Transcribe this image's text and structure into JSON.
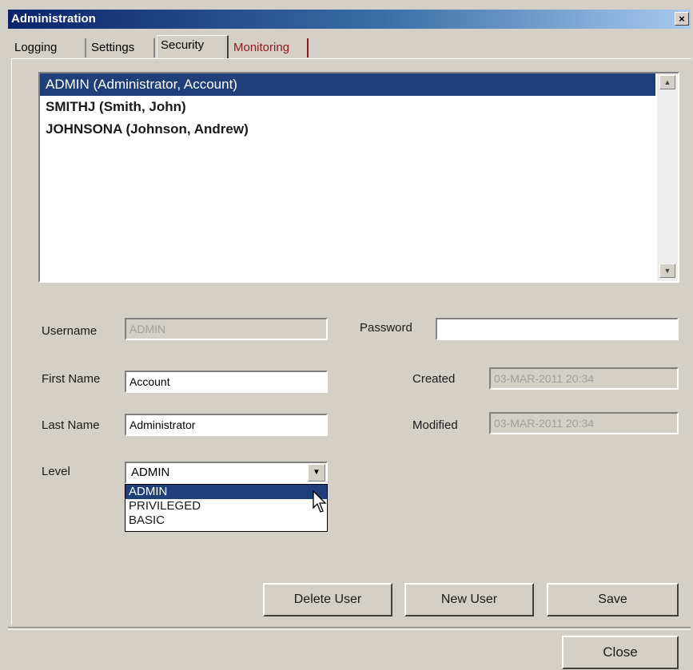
{
  "window": {
    "title": "Administration",
    "close_glyph": "×"
  },
  "tabs": [
    {
      "label": "Logging"
    },
    {
      "label": "Settings"
    },
    {
      "label": "Security"
    },
    {
      "label": "Monitoring"
    }
  ],
  "active_tab": "Security",
  "users": [
    {
      "label": "ADMIN (Administrator, Account)",
      "selected": true
    },
    {
      "label": "SMITHJ (Smith, John)",
      "selected": false
    },
    {
      "label": "JOHNSONA (Johnson, Andrew)",
      "selected": false
    }
  ],
  "form": {
    "username_label": "Username",
    "username_value": "ADMIN",
    "password_label": "Password",
    "password_value": "",
    "first_name_label": "First Name",
    "first_name_value": "Account",
    "created_label": "Created",
    "created_value": "03-MAR-2011 20:34",
    "last_name_label": "Last Name",
    "last_name_value": "Administrator",
    "modified_label": "Modified",
    "modified_value": "03-MAR-2011 20:34",
    "level_label": "Level",
    "level_value": "ADMIN",
    "level_options": [
      "ADMIN",
      "PRIVILEGED",
      "BASIC"
    ]
  },
  "buttons": {
    "delete": "Delete User",
    "new": "New User",
    "save": "Save",
    "close": "Close"
  },
  "colors": {
    "selection": "#1f3f7a",
    "title_start": "#0a246a",
    "title_end": "#a6caf0",
    "face": "#d4d0c8"
  }
}
